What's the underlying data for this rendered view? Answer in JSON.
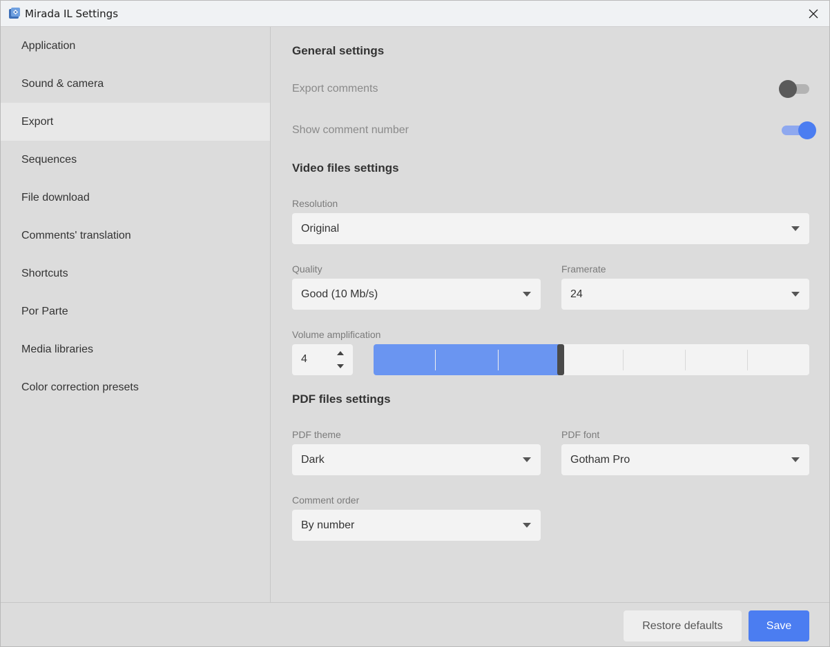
{
  "window": {
    "title": "Mirada IL Settings"
  },
  "sidebar": {
    "items": [
      {
        "label": "Application"
      },
      {
        "label": "Sound & camera"
      },
      {
        "label": "Export",
        "active": true
      },
      {
        "label": "Sequences"
      },
      {
        "label": "File download"
      },
      {
        "label": "Comments' translation"
      },
      {
        "label": "Shortcuts"
      },
      {
        "label": "Por Parte"
      },
      {
        "label": "Media libraries"
      },
      {
        "label": "Color correction presets"
      }
    ]
  },
  "general": {
    "title": "General settings",
    "export_comments": {
      "label": "Export comments",
      "enabled": false
    },
    "show_comment_number": {
      "label": "Show comment number",
      "enabled": true
    }
  },
  "video": {
    "title": "Video files settings",
    "resolution": {
      "label": "Resolution",
      "value": "Original"
    },
    "quality": {
      "label": "Quality",
      "value": "Good (10 Mb/s)"
    },
    "framerate": {
      "label": "Framerate",
      "value": "24"
    },
    "volume": {
      "label": "Volume amplification",
      "value": "4",
      "level": 4,
      "max": 7
    }
  },
  "pdf": {
    "title": "PDF files settings",
    "theme": {
      "label": "PDF theme",
      "value": "Dark"
    },
    "font": {
      "label": "PDF font",
      "value": "Gotham Pro"
    },
    "comment_order": {
      "label": "Comment order",
      "value": "By number"
    }
  },
  "footer": {
    "restore_label": "Restore defaults",
    "save_label": "Save"
  },
  "colors": {
    "accent": "#4b7df1",
    "slider_fill": "#6a95f1",
    "background": "#dcdcdc",
    "field_bg": "#f3f3f3"
  }
}
